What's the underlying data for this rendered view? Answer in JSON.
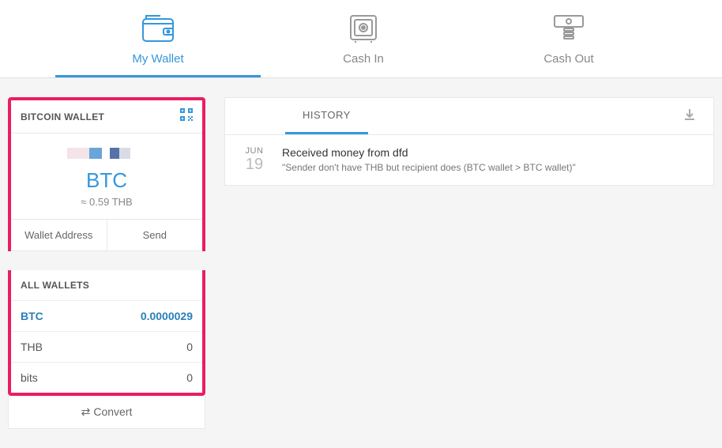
{
  "nav": {
    "tabs": [
      {
        "label": "My Wallet",
        "active": true
      },
      {
        "label": "Cash In",
        "active": false
      },
      {
        "label": "Cash Out",
        "active": false
      }
    ]
  },
  "wallet": {
    "header_title": "BITCOIN WALLET",
    "currency_label": "BTC",
    "approx_value": "≈ 0.59 THB",
    "actions": {
      "address": "Wallet Address",
      "send": "Send"
    }
  },
  "all_wallets": {
    "title": "ALL WALLETS",
    "rows": [
      {
        "currency": "BTC",
        "amount": "0.0000029",
        "active": true
      },
      {
        "currency": "THB",
        "amount": "0",
        "active": false
      },
      {
        "currency": "bits",
        "amount": "0",
        "active": false
      }
    ],
    "convert_label": "Convert"
  },
  "history": {
    "tab_label": "HISTORY",
    "transactions": [
      {
        "month": "JUN",
        "day": "19",
        "title": "Received money from dfd",
        "note": "\"Sender don't have THB but recipient does (BTC wallet > BTC wallet)\""
      }
    ]
  }
}
